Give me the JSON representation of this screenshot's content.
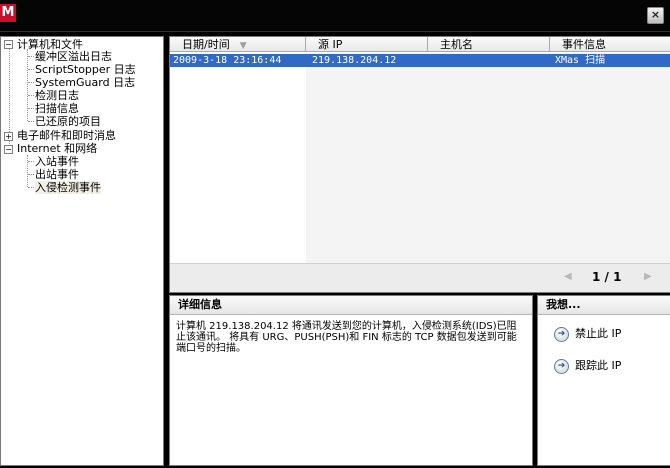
{
  "window": {
    "logo_text": "M",
    "close_icon": "close-icon"
  },
  "tree": {
    "root1": {
      "label": "计算机和文件",
      "expander": "−"
    },
    "children1": [
      "缓冲区溢出日志",
      "ScriptStopper 日志",
      "SystemGuard 日志",
      "检测日志",
      "扫描信息",
      "已还原的项目"
    ],
    "root2": {
      "label": "电子邮件和即时消息",
      "expander": "+"
    },
    "root3": {
      "label": "Internet 和网络",
      "expander": "−"
    },
    "children3": [
      "入站事件",
      "出站事件",
      "入侵检测事件"
    ],
    "selected": "入侵检测事件"
  },
  "list": {
    "columns": [
      "日期/时间",
      "源 IP",
      "主机名",
      "事件信息"
    ],
    "sort_icon": "sort-down-icon",
    "rows": [
      {
        "datetime": "2009-3-18 23:16:44",
        "source_ip": "219.138.204.12",
        "host": "",
        "event": "XMas 扫描"
      }
    ],
    "pager": {
      "text": "1 / 1",
      "prev": "◀",
      "next": "▶"
    }
  },
  "detail": {
    "header": "详细信息",
    "text": "计算机 219.138.204.12 将通讯发送到您的计算机，入侵检测系统(IDS)已阻止该通讯。 将具有 URG、PUSH(PSH)和 FIN 标志的 TCP 数据包发送到可能端口号的扫描。"
  },
  "actions": {
    "header": "我想...",
    "items": [
      "禁止此 IP",
      "跟踪此 IP"
    ]
  }
}
